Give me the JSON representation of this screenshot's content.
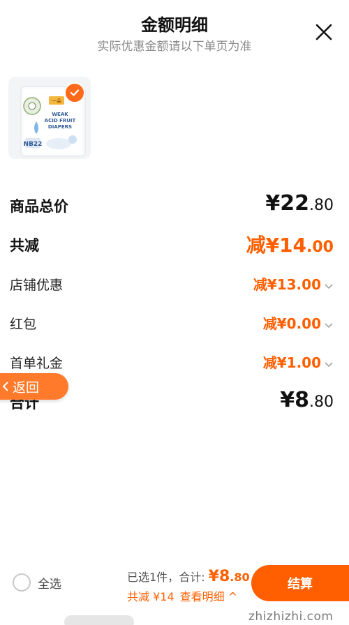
{
  "header": {
    "title": "金额明细",
    "subtitle": "实际优惠金额请以下单页为准"
  },
  "product": {
    "brand_badge": "一朵",
    "name_line1": "WEAK",
    "name_line2": "ACID FRUIT",
    "name_line3": "DIAPERS",
    "size_label": "NB22"
  },
  "rows": {
    "total_goods": {
      "label": "商品总价",
      "value_main": "¥22",
      "value_cents": ".80"
    },
    "total_discount": {
      "label": "共减",
      "value_main": "减¥14",
      "value_cents": ".00"
    },
    "store_discount": {
      "label": "店铺优惠",
      "value": "减¥13.00"
    },
    "red_packet": {
      "label": "红包",
      "value": "减¥0.00"
    },
    "first_order_gift": {
      "label": "首单礼金",
      "value": "减¥1.00"
    },
    "grand_total": {
      "label": "合计",
      "value_main": "¥8",
      "value_cents": ".80"
    }
  },
  "back_button": {
    "label": "返回"
  },
  "footer": {
    "select_all_label": "全选",
    "selected_text": "已选1件，",
    "total_label": "合计: ",
    "total_main": "¥8",
    "total_cents": ".80",
    "discount_text": "共减 ¥14",
    "detail_link": "查看明细 ^",
    "checkout_label": "结算",
    "watermark": "zhizhizhi.com"
  },
  "colors": {
    "accent": "#ff5f00",
    "back_button": "#ff7a2a"
  }
}
